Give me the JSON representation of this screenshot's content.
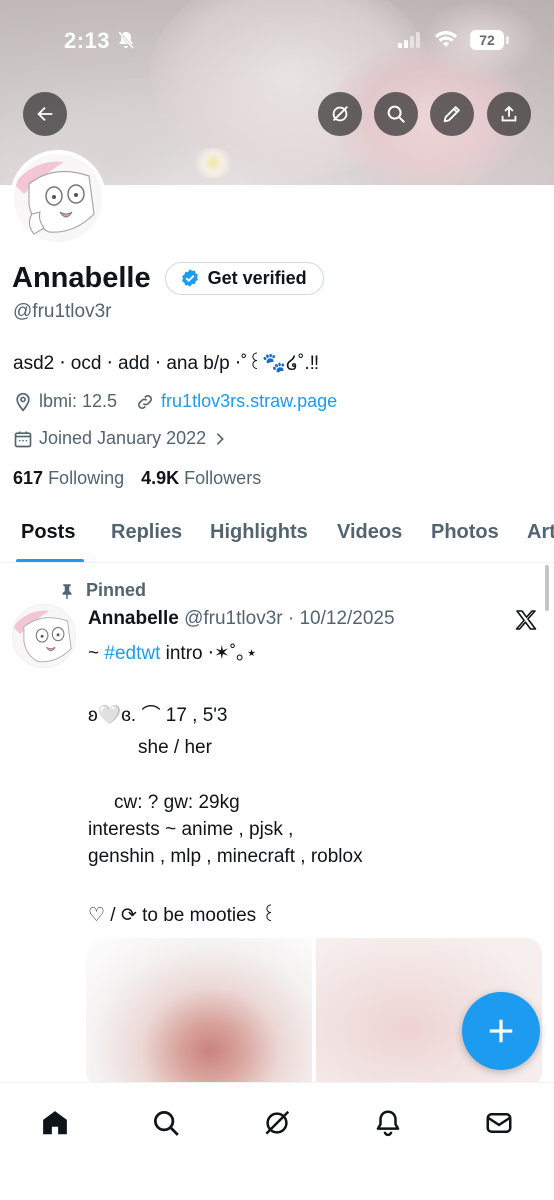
{
  "status_bar": {
    "time": "2:13",
    "battery": "72"
  },
  "profile": {
    "name": "Annabelle",
    "verify_label": "Get verified",
    "handle": "@fru1tlov3r",
    "bio": "asd2 ‧ ocd ‧ add ‧ ana b/p ‧˚꒰🐾໒˚.‼",
    "location": "lbmi: 12.5",
    "website": "fru1tlov3rs.straw.page",
    "joined": "Joined January 2022",
    "following_count": "617",
    "following_label": "Following",
    "followers_count": "4.9K",
    "followers_label": "Followers"
  },
  "tabs": [
    "Posts",
    "Replies",
    "Highlights",
    "Videos",
    "Photos",
    "Articles"
  ],
  "post": {
    "pinned_label": "Pinned",
    "author": "Annabelle",
    "meta": "@fru1tlov3r · 10/12/2025",
    "line1_prefix": "~ ",
    "line1_tag": "#edtwt",
    "line1_suffix": " intro ‧✶˚｡⋆",
    "line2": "ʚ🤍ɞ. ⌒ 17 , 5'3",
    "line3": "she / her",
    "line4": "cw: ? gw: 29kg",
    "line5": "interests ~ anime , pjsk ,",
    "line6": "genshin , mlp , minecraft , roblox",
    "line7": "♡ / ⟳ to be mooties ꒰"
  },
  "icons": {
    "back": "arrow-left-icon",
    "grok": "grok-icon",
    "search": "search-icon",
    "edit": "pencil-icon",
    "share": "share-icon",
    "x_logo": "x-logo-icon",
    "compose": "plus-icon",
    "nav": [
      "home-icon",
      "search-icon",
      "grok-icon",
      "bell-icon",
      "mail-icon"
    ]
  },
  "colors": {
    "accent": "#1d9bf0",
    "text": "#0f1419",
    "muted": "#536471"
  }
}
